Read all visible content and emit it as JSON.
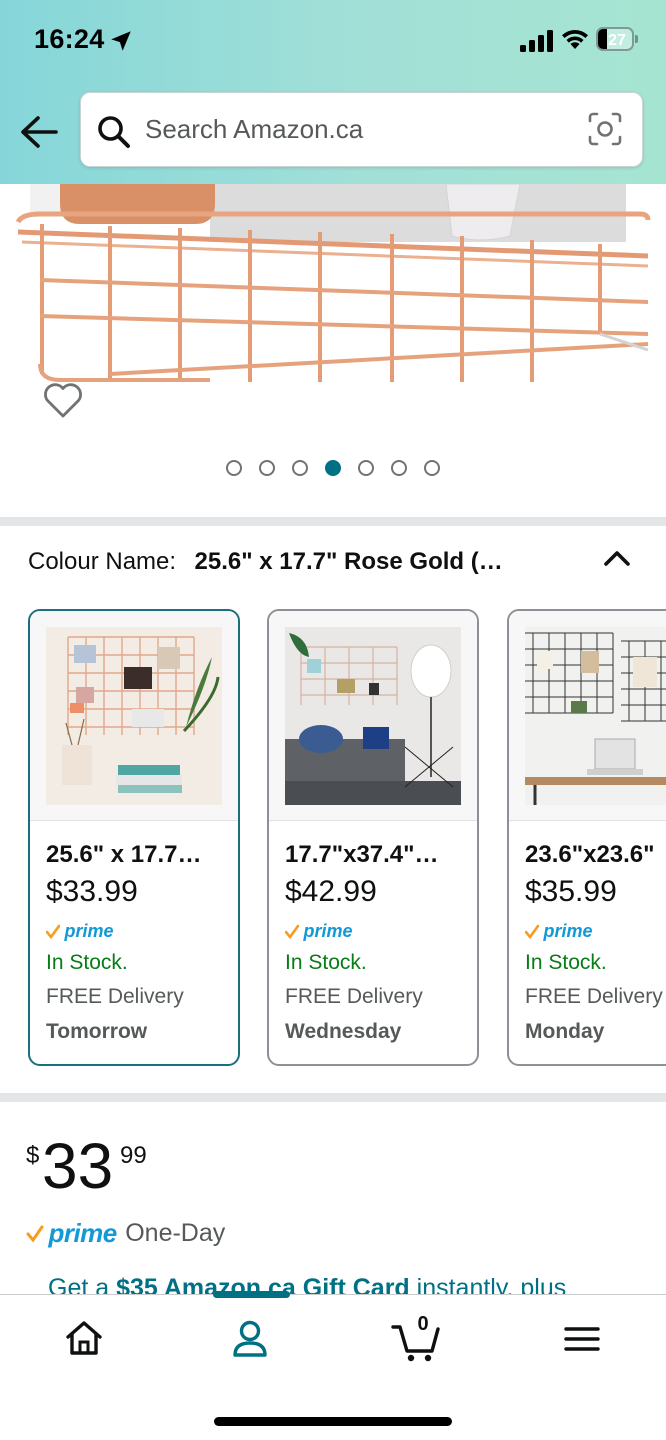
{
  "status_bar": {
    "time": "16:24",
    "battery": "27",
    "battery_level": 0.27
  },
  "search": {
    "placeholder": "Search Amazon.ca",
    "value": ""
  },
  "icons": {
    "back": "back-arrow-icon",
    "search": "search-icon",
    "camera": "camera-scan-icon",
    "wishlist": "heart-icon",
    "collapse": "chevron-up-icon",
    "nav_home": "home-icon",
    "nav_account": "person-icon",
    "nav_cart": "cart-icon",
    "nav_menu": "hamburger-menu-icon"
  },
  "carousel": {
    "dot_count": 7,
    "active_index": 3
  },
  "colour": {
    "label": "Colour Name:",
    "value": "25.6\" x 17.7\" Rose Gold (…"
  },
  "swatches": [
    {
      "title": "25.6\" x 17.7…",
      "price": "$33.99",
      "prime": "prime",
      "stock": "In Stock.",
      "delivery": "FREE Delivery",
      "day": "Tomorrow",
      "selected": true
    },
    {
      "title": "17.7\"x37.4\"…",
      "price": "$42.99",
      "prime": "prime",
      "stock": "In Stock.",
      "delivery": "FREE Delivery",
      "day": "Wednesday",
      "selected": false
    },
    {
      "title": "23.6\"x23.6\"",
      "price": "$35.99",
      "prime": "prime",
      "stock": "In Stock.",
      "delivery": "FREE Delivery",
      "day": "Monday",
      "selected": false
    }
  ],
  "price": {
    "symbol": "$",
    "whole": "33",
    "fraction": "99"
  },
  "prime_delivery": {
    "prime": "prime",
    "text": "One-Day"
  },
  "gift_card": {
    "prefix": "Get a ",
    "bold": "$35 Amazon.ca Gift Card",
    "suffix": " instantly, plus"
  },
  "bottom_nav": {
    "cart_count": "0",
    "active": "account"
  },
  "colors": {
    "accent": "#007185",
    "prime_blue": "#1399d6",
    "in_stock_green": "#067d16",
    "header_gradient_start": "#86d6d9",
    "header_gradient_end": "#a6e4d2",
    "rose_gold": "#e8a07c"
  }
}
